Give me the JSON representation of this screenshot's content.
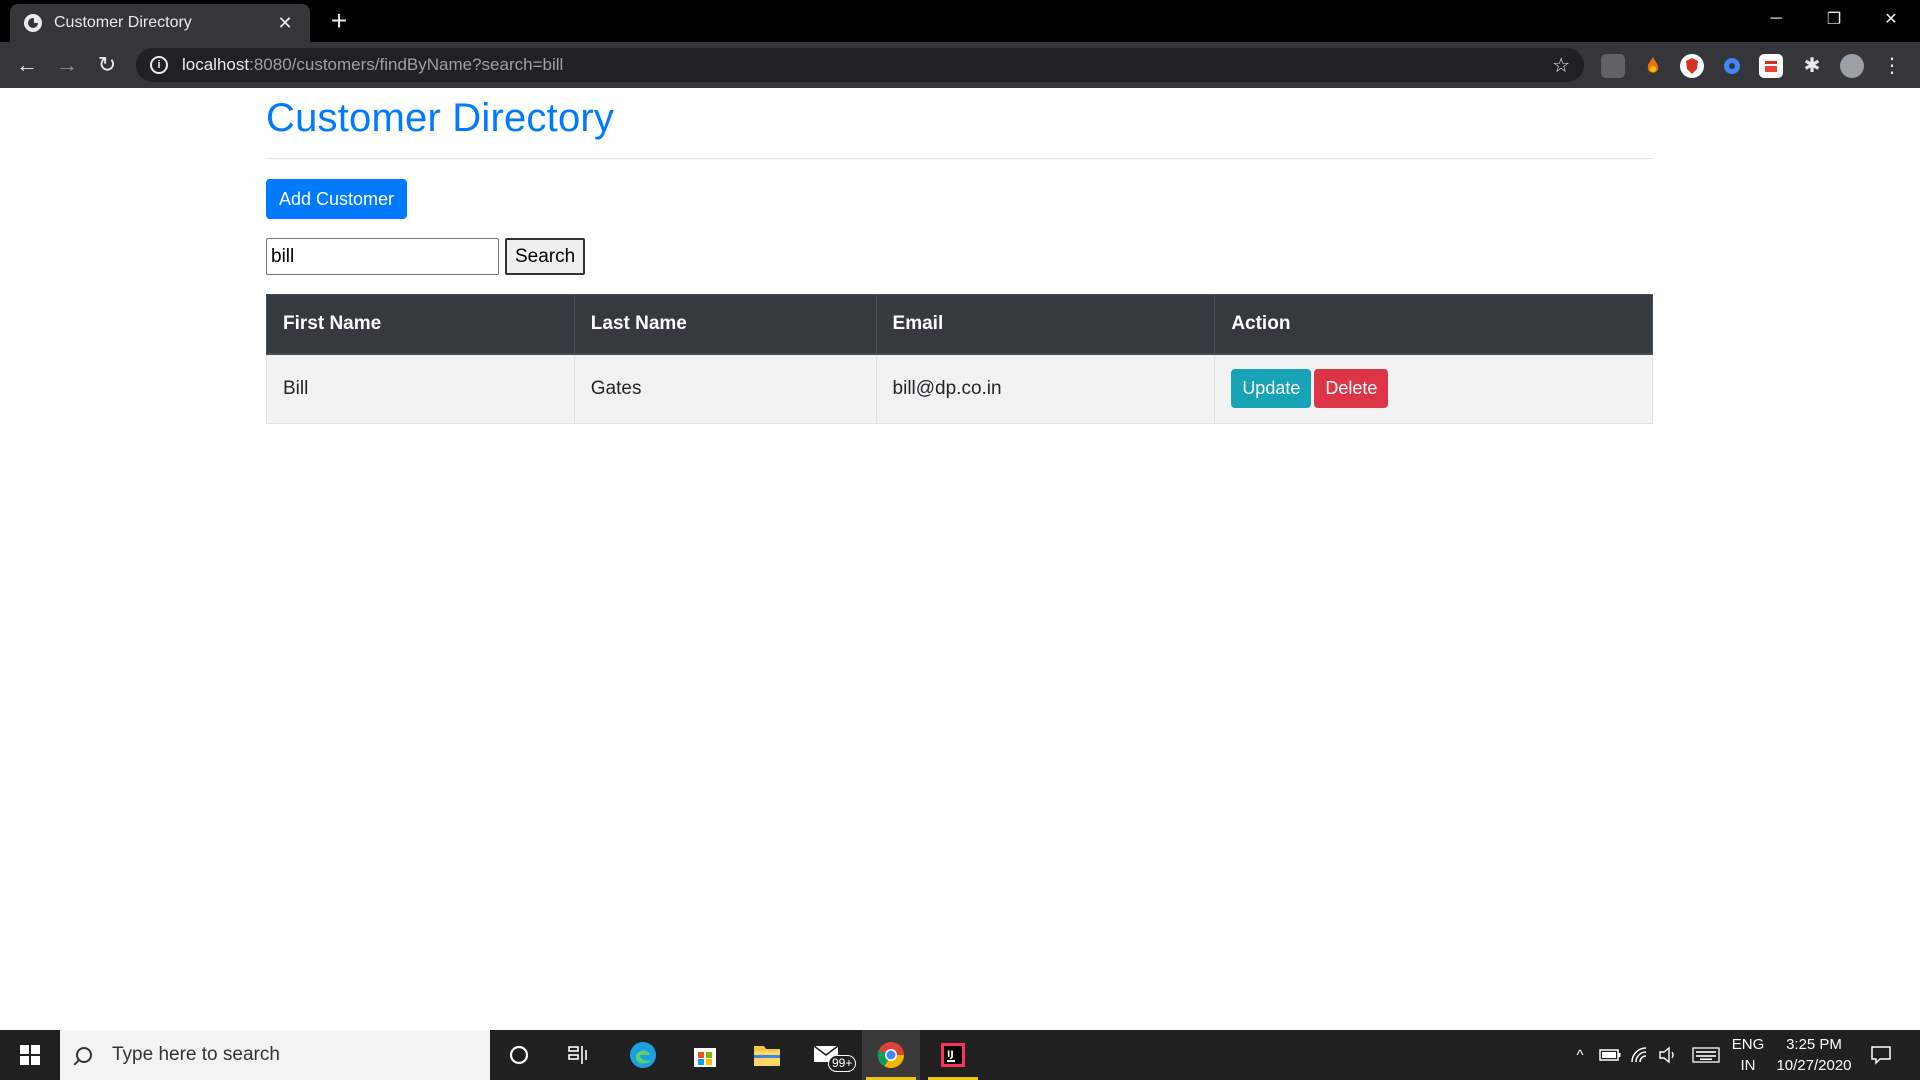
{
  "browser": {
    "tab_title": "Customer Directory",
    "tab_close": "✕",
    "new_tab": "+",
    "url_host": "localhost",
    "url_rest": ":8080/customers/findByName?search=bill",
    "window_controls": {
      "minimize": "─",
      "restore": "❐",
      "close": "✕"
    }
  },
  "page": {
    "title": "Customer Directory",
    "add_button": "Add Customer",
    "search": {
      "value": "bill",
      "button": "Search"
    },
    "table": {
      "headers": [
        "First Name",
        "Last Name",
        "Email",
        "Action"
      ],
      "rows": [
        {
          "first_name": "Bill",
          "last_name": "Gates",
          "email": "bill@dp.co.in",
          "update": "Update",
          "delete": "Delete"
        }
      ]
    }
  },
  "colors": {
    "primary": "#007bff",
    "info": "#17a2b8",
    "danger": "#dc3545",
    "table_header": "#343a40"
  },
  "taskbar": {
    "search_placeholder": "Type here to search",
    "mail_badge": "99+",
    "language": {
      "line1": "ENG",
      "line2": "IN"
    },
    "time": "3:25 PM",
    "date": "10/27/2020",
    "icons": [
      "windows-start-icon",
      "cortana-icon",
      "task-view-icon",
      "edge-icon",
      "store-icon",
      "file-explorer-icon",
      "mail-icon",
      "chrome-icon",
      "intellij-icon"
    ]
  }
}
